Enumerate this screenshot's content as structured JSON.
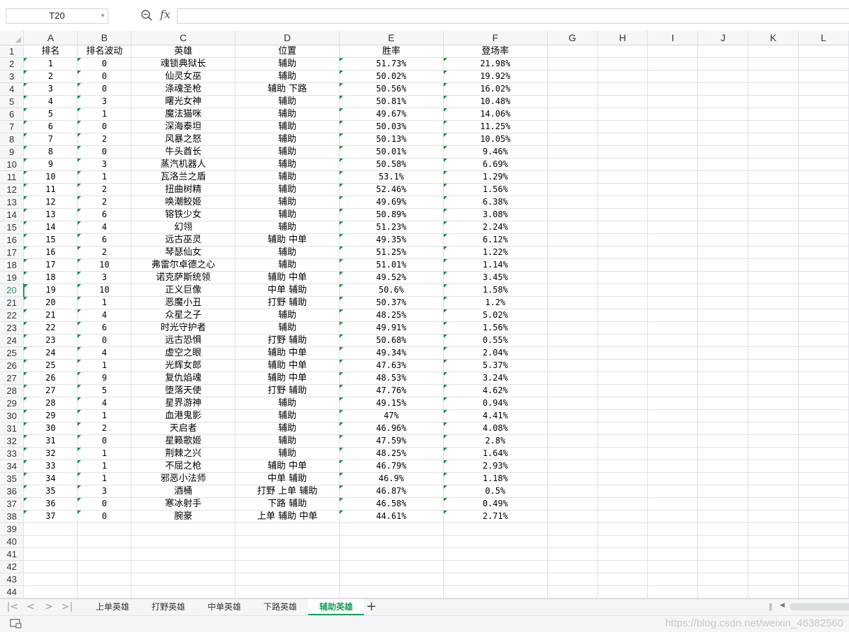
{
  "formula_bar": {
    "name_box": "T20",
    "fx_label": "fx",
    "formula": ""
  },
  "columns": [
    "A",
    "B",
    "C",
    "D",
    "E",
    "F",
    "G",
    "H",
    "I",
    "J",
    "K",
    "L"
  ],
  "selected_row": 20,
  "header_row": [
    "排名",
    "排名波动",
    "英雄",
    "位置",
    "胜率",
    "登场率"
  ],
  "data_rows": [
    [
      "1",
      "0",
      "魂锁典狱长",
      "辅助",
      "51.73%",
      "21.98%"
    ],
    [
      "2",
      "0",
      "仙灵女巫",
      "辅助",
      "50.02%",
      "19.92%"
    ],
    [
      "3",
      "0",
      "涤魂圣枪",
      "辅助 下路",
      "50.56%",
      "16.02%"
    ],
    [
      "4",
      "3",
      "曙光女神",
      "辅助",
      "50.81%",
      "10.48%"
    ],
    [
      "5",
      "1",
      "魔法猫咪",
      "辅助",
      "49.67%",
      "14.06%"
    ],
    [
      "6",
      "0",
      "深海泰坦",
      "辅助",
      "50.03%",
      "11.25%"
    ],
    [
      "7",
      "2",
      "风暴之怒",
      "辅助",
      "50.13%",
      "10.05%"
    ],
    [
      "8",
      "0",
      "牛头酋长",
      "辅助",
      "50.01%",
      "9.46%"
    ],
    [
      "9",
      "3",
      "蒸汽机器人",
      "辅助",
      "50.58%",
      "6.69%"
    ],
    [
      "10",
      "1",
      "瓦洛兰之盾",
      "辅助",
      "53.1%",
      "1.29%"
    ],
    [
      "11",
      "2",
      "扭曲树精",
      "辅助",
      "52.46%",
      "1.56%"
    ],
    [
      "12",
      "2",
      "唤潮鲛姬",
      "辅助",
      "49.69%",
      "6.38%"
    ],
    [
      "13",
      "6",
      "镕铁少女",
      "辅助",
      "50.89%",
      "3.08%"
    ],
    [
      "14",
      "4",
      "幻翎",
      "辅助",
      "51.23%",
      "2.24%"
    ],
    [
      "15",
      "6",
      "远古巫灵",
      "辅助 中单",
      "49.35%",
      "6.12%"
    ],
    [
      "16",
      "2",
      "琴瑟仙女",
      "辅助",
      "51.25%",
      "1.22%"
    ],
    [
      "17",
      "10",
      "弗雷尔卓德之心",
      "辅助",
      "51.01%",
      "1.14%"
    ],
    [
      "18",
      "3",
      "诺克萨斯统领",
      "辅助 中单",
      "49.52%",
      "3.45%"
    ],
    [
      "19",
      "10",
      "正义巨像",
      "中单 辅助",
      "50.6%",
      "1.58%"
    ],
    [
      "20",
      "1",
      "恶魔小丑",
      "打野 辅助",
      "50.37%",
      "1.2%"
    ],
    [
      "21",
      "4",
      "众星之子",
      "辅助",
      "48.25%",
      "5.02%"
    ],
    [
      "22",
      "6",
      "时光守护者",
      "辅助",
      "49.91%",
      "1.56%"
    ],
    [
      "23",
      "0",
      "远古恐惧",
      "打野 辅助",
      "50.68%",
      "0.55%"
    ],
    [
      "24",
      "4",
      "虚空之眼",
      "辅助 中单",
      "49.34%",
      "2.04%"
    ],
    [
      "25",
      "1",
      "光辉女郎",
      "辅助 中单",
      "47.63%",
      "5.37%"
    ],
    [
      "26",
      "9",
      "复仇焰魂",
      "辅助 中单",
      "48.53%",
      "3.24%"
    ],
    [
      "27",
      "5",
      "堕落天使",
      "打野 辅助",
      "47.76%",
      "4.62%"
    ],
    [
      "28",
      "4",
      "星界游神",
      "辅助",
      "49.15%",
      "0.94%"
    ],
    [
      "29",
      "1",
      "血港鬼影",
      "辅助",
      "47%",
      "4.41%"
    ],
    [
      "30",
      "2",
      "天启者",
      "辅助",
      "46.96%",
      "4.08%"
    ],
    [
      "31",
      "0",
      "星籁歌姬",
      "辅助",
      "47.59%",
      "2.8%"
    ],
    [
      "32",
      "1",
      "荆棘之兴",
      "辅助",
      "48.25%",
      "1.64%"
    ],
    [
      "33",
      "1",
      "不屈之枪",
      "辅助 中单",
      "46.79%",
      "2.93%"
    ],
    [
      "34",
      "1",
      "邪恶小法师",
      "中单 辅助",
      "46.9%",
      "1.18%"
    ],
    [
      "35",
      "3",
      "酒桶",
      "打野 上单 辅助",
      "46.87%",
      "0.5%"
    ],
    [
      "36",
      "0",
      "寒冰射手",
      "下路 辅助",
      "46.58%",
      "0.49%"
    ],
    [
      "37",
      "0",
      "腕豪",
      "上单 辅助 中单",
      "44.61%",
      "2.71%"
    ]
  ],
  "total_rows": 44,
  "sheet_tabs": [
    "上单英雄",
    "打野英雄",
    "中单英雄",
    "下路英雄",
    "辅助英雄"
  ],
  "active_tab": "辅助英雄",
  "add_tab_label": "+",
  "nav_buttons": [
    "|<",
    "<",
    ">",
    ">|"
  ],
  "watermark": "https://blog.csdn.net/weixin_46382560",
  "colors": {
    "accent_green": "#1e9c5a",
    "grid_line": "#dde1e6",
    "header_bg": "#f5f6f7",
    "error_marker": "#1b8a3a"
  }
}
